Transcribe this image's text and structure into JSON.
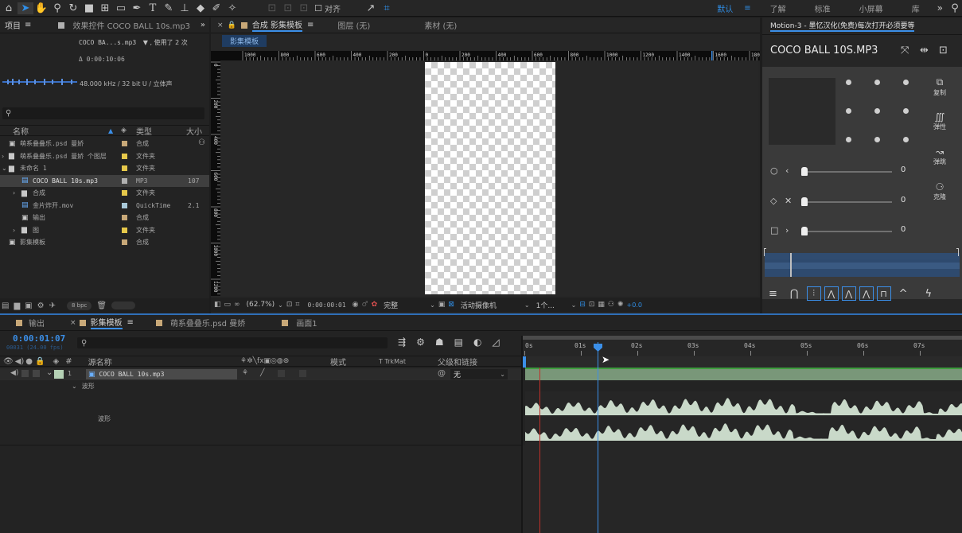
{
  "toolbar": {
    "snap_label": "对齐",
    "workspaces": [
      "默认",
      "了解",
      "标准",
      "小屏幕",
      "库"
    ],
    "more": "»",
    "menu_glyph": "≡"
  },
  "project": {
    "tab_project": "项目",
    "tab_effects": "效果控件 COCO BALL 10s.mp3",
    "file_name": "COCO BA...s.mp3",
    "used_text": "▼ , 使用了 2 次",
    "duration": "Δ 0:00:10:06",
    "audio_info": "48.000 kHz / 32 bit U / 立体声",
    "search_placeholder": "",
    "col_name": "名称",
    "col_type": "类型",
    "col_size": "大小",
    "items": [
      {
        "name": "萌系叠叠乐.psd 曼娇",
        "type": "合成",
        "size": "",
        "color": "#c8a878",
        "indent": 0,
        "icon": "comp"
      },
      {
        "name": "萌系叠叠乐.psd 曼娇 个图层",
        "type": "文件夹",
        "size": "",
        "color": "#e6c84a",
        "indent": 0,
        "icon": "folder"
      },
      {
        "name": "未命名 1",
        "type": "文件夹",
        "size": "",
        "color": "#e6c84a",
        "indent": 0,
        "icon": "folder"
      },
      {
        "name": "COCO BALL 10s.mp3",
        "type": "MP3",
        "size": "107",
        "color": "#b0b0b0",
        "indent": 1,
        "icon": "audio"
      },
      {
        "name": "合成",
        "type": "文件夹",
        "size": "",
        "color": "#e6c84a",
        "indent": 1,
        "icon": "folder"
      },
      {
        "name": "金片炸开.mov",
        "type": "QuickTime",
        "size": "2.1",
        "color": "#a8c8d8",
        "indent": 1,
        "icon": "video"
      },
      {
        "name": "输出",
        "type": "合成",
        "size": "",
        "color": "#c8a878",
        "indent": 1,
        "icon": "comp"
      },
      {
        "name": "图",
        "type": "文件夹",
        "size": "",
        "color": "#e6c84a",
        "indent": 1,
        "icon": "folder"
      },
      {
        "name": "影集模板",
        "type": "合成",
        "size": "",
        "color": "#c8a878",
        "indent": 0,
        "icon": "comp"
      }
    ],
    "bpc": "8 bpc"
  },
  "comp": {
    "tab_comp": "合成 影集模板",
    "tab_layer": "图层 (无)",
    "tab_footage": "素材 (无)",
    "subtab": "影集模板",
    "ruler_labels": [
      "1000",
      "800",
      "600",
      "400",
      "200",
      "0",
      "200",
      "400",
      "600",
      "800",
      "1000",
      "1200",
      "1400",
      "1600",
      "180"
    ],
    "vruler_labels": [
      "0",
      "200",
      "400",
      "600",
      "800",
      "1000",
      "1200"
    ],
    "zoom": "(62.7%)",
    "timecode": "0:00:00:01",
    "quality": "完整",
    "camera": "活动摄像机",
    "views": "1个...",
    "exposure": "+0.0"
  },
  "motion": {
    "title": "Motion-3 - 墨忆汉化(免费)每次打开必须要等",
    "file": "COCO BALL 10S.MP3",
    "buttons": [
      "复制",
      "弹性",
      "弹跳",
      "克隆"
    ],
    "values": [
      "0",
      "0",
      "0"
    ]
  },
  "timeline": {
    "tabs": [
      "输出",
      "影集模板",
      "萌系叠叠乐.psd 曼娇",
      "画面1"
    ],
    "timecode": "0:00:01:07",
    "frame_info": "00031 (24.00 fps)",
    "col_source": "源名称",
    "col_mode": "模式",
    "col_trkmat": "T  TrkMat",
    "col_parent": "父级和链接",
    "layer_num": "1",
    "layer_name": "COCO BALL 10s.mp3",
    "parent_value": "无",
    "waveform_group": "波形",
    "waveform_label": "波形",
    "time_marks": [
      "0s",
      "01s",
      "02s",
      "03s",
      "04s",
      "05s",
      "06s",
      "07s"
    ]
  }
}
